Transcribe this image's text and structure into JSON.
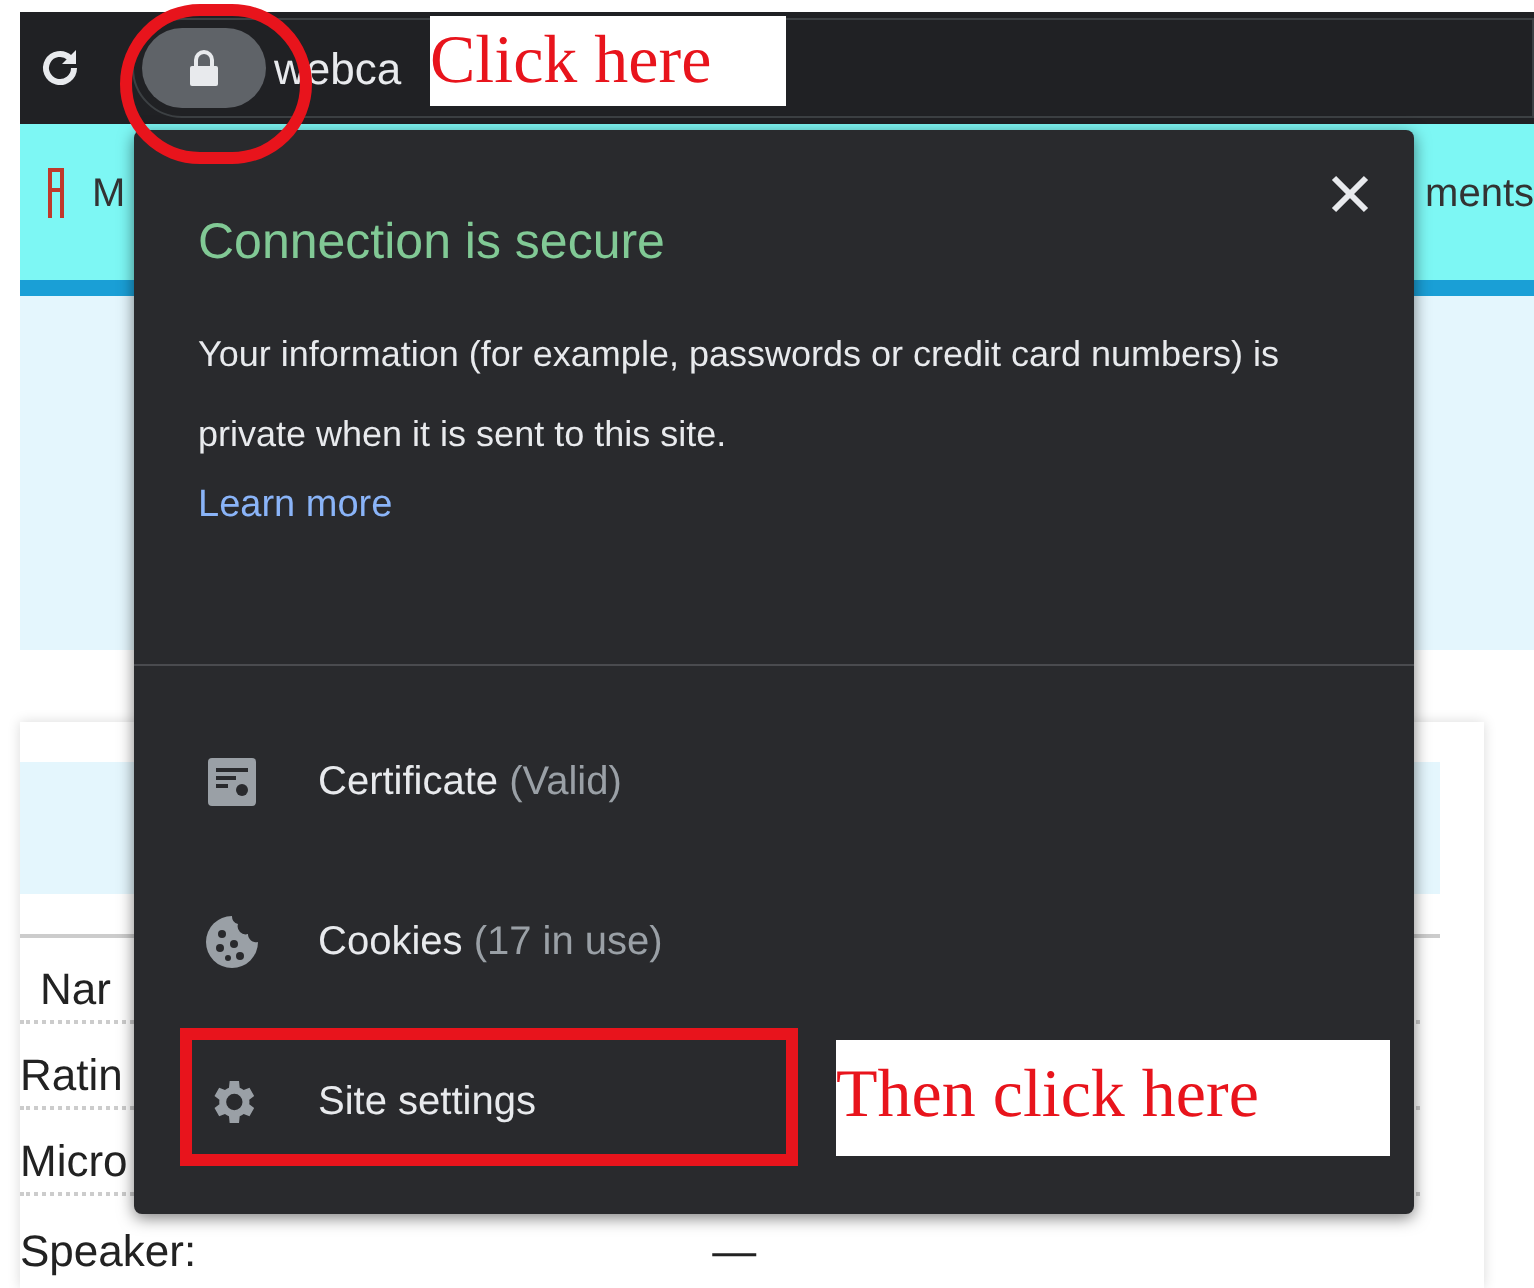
{
  "toolbar": {
    "address": "webca"
  },
  "bookmarks_bar": {
    "item_1": "M",
    "item_2": "ments"
  },
  "page": {
    "rows": [
      {
        "label": "Nar"
      },
      {
        "label": "Ratin"
      },
      {
        "label": "Micro"
      },
      {
        "label": "Speaker:",
        "value": "—"
      }
    ]
  },
  "popup": {
    "title": "Connection is secure",
    "message": "Your information (for example, passwords or credit card numbers) is private when it is sent to this site.",
    "link": "Learn more",
    "items": [
      {
        "kind": "certificate",
        "label": "Certificate",
        "detail": "(Valid)"
      },
      {
        "kind": "cookies",
        "label": "Cookies",
        "detail": "(17 in use)"
      },
      {
        "kind": "settings",
        "label": "Site settings"
      }
    ]
  },
  "annotations": {
    "first": "Click here",
    "second": "Then click here"
  }
}
